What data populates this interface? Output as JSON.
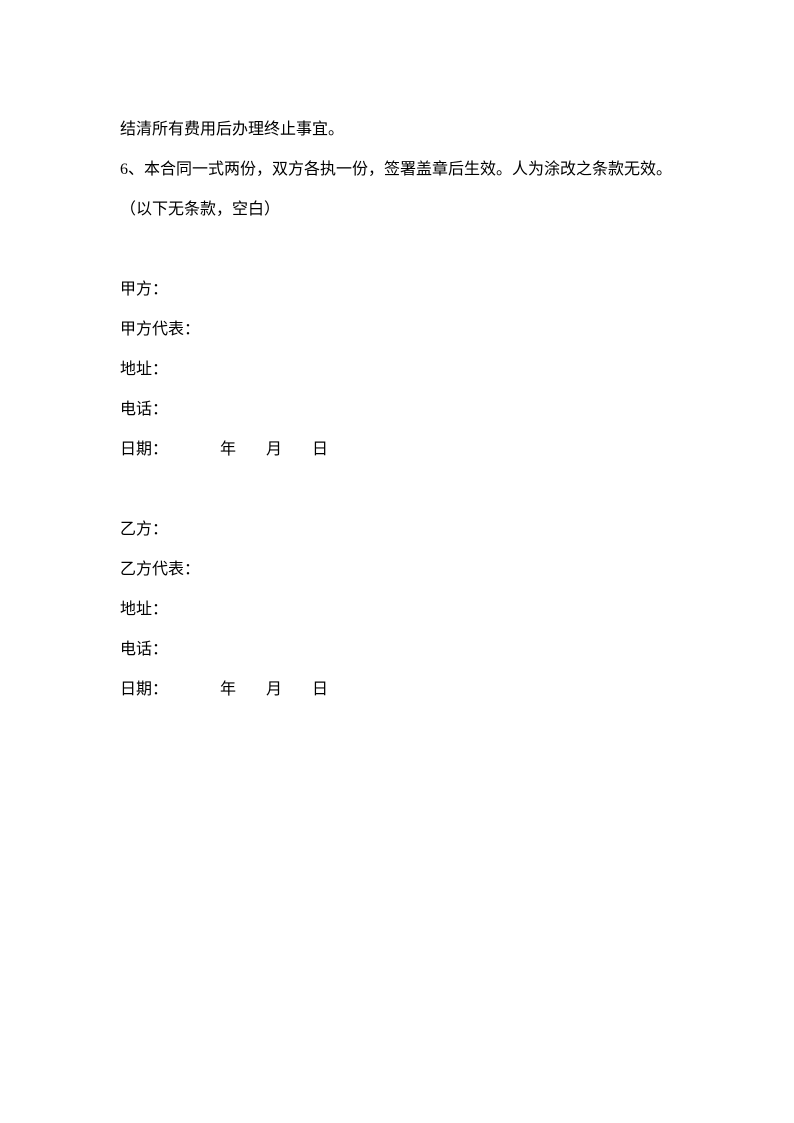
{
  "body": {
    "line1": "结清所有费用后办理终止事宜。",
    "line2": "6、本合同一式两份，双方各执一份，签署盖章后生效。人为涂改之条款无效。",
    "line3": "（以下无条款，空白）"
  },
  "partyA": {
    "title": "甲方：",
    "rep": "甲方代表：",
    "addr": "地址：",
    "phone": "电话：",
    "dateLabel": "日期：",
    "year": "年",
    "month": "月",
    "day": "日"
  },
  "partyB": {
    "title": "乙方：",
    "rep": "乙方代表：",
    "addr": "地址：",
    "phone": "电话：",
    "dateLabel": "日期：",
    "year": "年",
    "month": "月",
    "day": "日"
  }
}
